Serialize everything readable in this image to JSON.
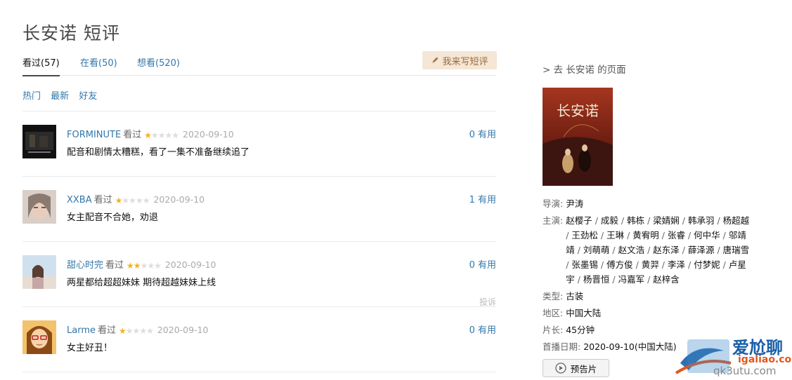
{
  "page": {
    "title": "长安诺 短评"
  },
  "tabs": [
    {
      "label": "看过(57)",
      "active": true
    },
    {
      "label": "在看(50)",
      "active": false
    },
    {
      "label": "想看(520)",
      "active": false
    }
  ],
  "write_button": {
    "label": "我来写短评",
    "icon": "pencil-icon"
  },
  "sorts": [
    "热门",
    "最新",
    "好友"
  ],
  "comments": [
    {
      "user": "FORMINUTE",
      "status": "看过",
      "rating": 1,
      "date": "2020-09-10",
      "text": "配音和剧情太糟糕，看了一集不准备继续追了",
      "useful": "0 有用",
      "report": ""
    },
    {
      "user": "XXBA",
      "status": "看过",
      "rating": 1,
      "date": "2020-09-10",
      "text": "女主配音不合她，劝退",
      "useful": "1 有用",
      "report": ""
    },
    {
      "user": "甜心时完",
      "status": "看过",
      "rating": 2,
      "date": "2020-09-10",
      "text": "两星都给超超妹妹 期待超越妹妹上线",
      "useful": "0 有用",
      "report": "投诉"
    },
    {
      "user": "Larme",
      "status": "看过",
      "rating": 1,
      "date": "2020-09-10",
      "text": "女主好丑！",
      "useful": "0 有用",
      "report": ""
    }
  ],
  "sidebar": {
    "back_link": "> 去 长安诺 的页面",
    "poster_text": "长安诺",
    "director_label": "导演:",
    "director": "尹涛",
    "cast_label": "主演:",
    "cast": [
      "赵樱子",
      "成毅",
      "韩栋",
      "梁婧娴",
      "韩承羽",
      "杨超越",
      "王劲松",
      "王琳",
      "黄宥明",
      "张睿",
      "何中华",
      "邬靖靖",
      "刘萌萌",
      "赵文浩",
      "赵东泽",
      "薛泽源",
      "唐瑞雪",
      "张墨锡",
      "傅方俊",
      "黄羿",
      "李泽",
      "付梦妮",
      "卢星宇",
      "杨晋恒",
      "冯嘉军",
      "赵梓含"
    ],
    "genre_label": "类型:",
    "genre": "古装",
    "region_label": "地区:",
    "region": "中国大陆",
    "length_label": "片长:",
    "length": "45分钟",
    "release_label": "首播日期:",
    "release": "2020-09-10(中国大陆)",
    "trailer_label": "预告片"
  },
  "watermark": {
    "line1": "爱尬聊",
    "line2": "igaliao.com",
    "line3": "qk3utu.com"
  },
  "colors": {
    "link": "#3377aa",
    "star": "#f5b21b",
    "write_btn_bg": "#f5e6d6"
  }
}
